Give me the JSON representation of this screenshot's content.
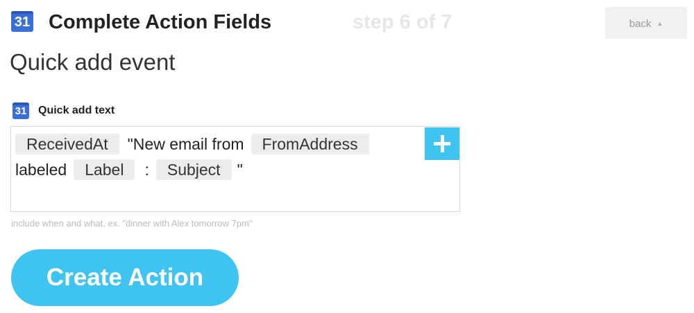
{
  "header": {
    "icon": "calendar-icon",
    "icon_number": "31",
    "title": "Complete Action Fields",
    "step": "step 6 of 7",
    "back_label": "back",
    "back_caret": "▲"
  },
  "section": {
    "title": "Quick add event"
  },
  "field": {
    "icon": "calendar-icon",
    "icon_number": "31",
    "label": "Quick add text",
    "tokens": {
      "received_at": "ReceivedAt",
      "text_new_email": "\"New email from",
      "from_address": "FromAddress",
      "text_labeled": "labeled",
      "label": "Label",
      "text_colon": ":",
      "subject": "Subject",
      "text_quote": "\""
    },
    "add_icon": "plus-icon",
    "hint": "include when and what, ex. \"dinner with Alex tomorrow 7pm\""
  },
  "actions": {
    "create_label": "Create Action"
  },
  "colors": {
    "accent": "#3fc4f1",
    "calendar_blue": "#3a6fd8",
    "pill_bg": "#ececec",
    "step_text": "#e6e6e6"
  }
}
